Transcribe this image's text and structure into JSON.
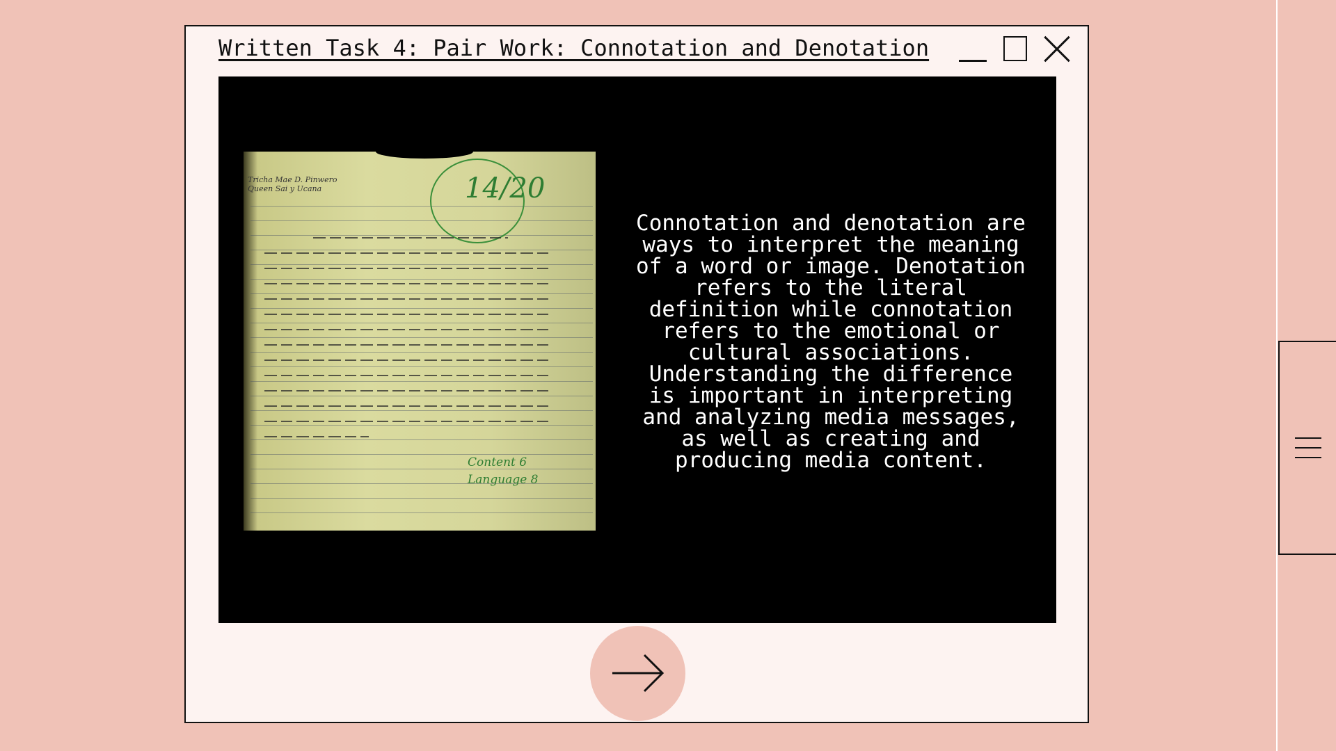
{
  "window": {
    "title": "Written Task 4: Pair Work: Connotation and Denotation",
    "controls": [
      "minimize-icon",
      "maximize-icon",
      "close-icon"
    ]
  },
  "content": {
    "photo": {
      "subject": "handwritten essay on yellow lined paper",
      "header_lines": [
        "Tricha Mae D. Pinwero",
        "Queen Sai y Ucana"
      ],
      "score_mark": "14/20",
      "footer_marks": [
        "Content 6",
        "Language 8"
      ]
    },
    "description": "Connotation and denotation are\nways to interpret the meaning\nof a word or image. Denotation\nrefers to the literal\ndefinition while connotation\nrefers to the emotional or\ncultural associations.\nUnderstanding the difference\nis important in interpreting\nand analyzing media messages,\nas well as creating and\nproducing media content."
  },
  "navigation": {
    "next_icon": "arrow-right-icon",
    "menu_icon": "hamburger-menu-icon"
  },
  "colors": {
    "background": "#f0c2b7",
    "window": "#fdf3f1",
    "stage": "#000000",
    "accent": "#f0c2b7"
  }
}
